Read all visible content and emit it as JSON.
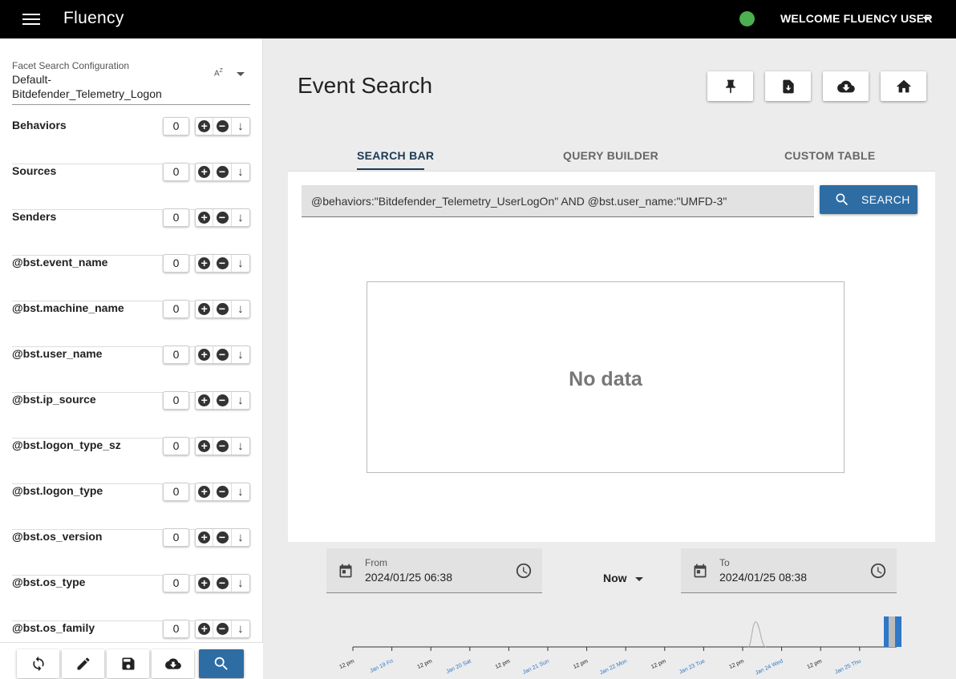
{
  "app": {
    "title": "Fluency",
    "welcome": "WELCOME FLUENCY USER",
    "status_color": "#4caf50"
  },
  "sidebar": {
    "config_label": "Facet Search Configuration",
    "config_value": "Default-Bitdefender_Telemetry_Logon",
    "sort_icon": "az-sort-icon",
    "facets": [
      {
        "name": "Behaviors",
        "count": "0"
      },
      {
        "name": "Sources",
        "count": "0"
      },
      {
        "name": "Senders",
        "count": "0"
      },
      {
        "name": "@bst.event_name",
        "count": "0"
      },
      {
        "name": "@bst.machine_name",
        "count": "0"
      },
      {
        "name": "@bst.user_name",
        "count": "0"
      },
      {
        "name": "@bst.ip_source",
        "count": "0"
      },
      {
        "name": "@bst.logon_type_sz",
        "count": "0"
      },
      {
        "name": "@bst.logon_type",
        "count": "0"
      },
      {
        "name": "@bst.os_version",
        "count": "0"
      },
      {
        "name": "@bst.os_type",
        "count": "0"
      },
      {
        "name": "@bst.os_family",
        "count": "0"
      }
    ],
    "toolbar_icons": [
      "refresh-icon",
      "edit-icon",
      "save-icon",
      "cloud-download-icon",
      "search-icon"
    ]
  },
  "main": {
    "title": "Event Search",
    "toolbar_icons": [
      "pin-icon",
      "file-download-icon",
      "cloud-download-icon",
      "home-icon"
    ],
    "tabs": [
      {
        "label": "SEARCH BAR",
        "active": true
      },
      {
        "label": "QUERY BUILDER",
        "active": false
      },
      {
        "label": "CUSTOM TABLE",
        "active": false
      }
    ],
    "query": "@behaviors:\"Bitdefender_Telemetry_UserLogOn\" AND @bst.user_name:\"UMFD-3\"",
    "search_label": "SEARCH",
    "no_data": "No data",
    "accent": "#2e6da4"
  },
  "range": {
    "from_label": "From",
    "from_value": "2024/01/25 06:38",
    "preset": "Now",
    "to_label": "To",
    "to_value": "2024/01/25 08:38"
  },
  "timeline": {
    "ticks": [
      "12 pm",
      "Jan 19 Fri",
      "12 pm",
      "Jan 20 Sat",
      "12 pm",
      "Jan 21 Sun",
      "12 pm",
      "Jan 22 Mon",
      "12 pm",
      "Jan 23 Tue",
      "12 pm",
      "Jan 24 Wed",
      "12 pm",
      "Jan 25 Thu"
    ],
    "day_color": "#2e78c8"
  }
}
